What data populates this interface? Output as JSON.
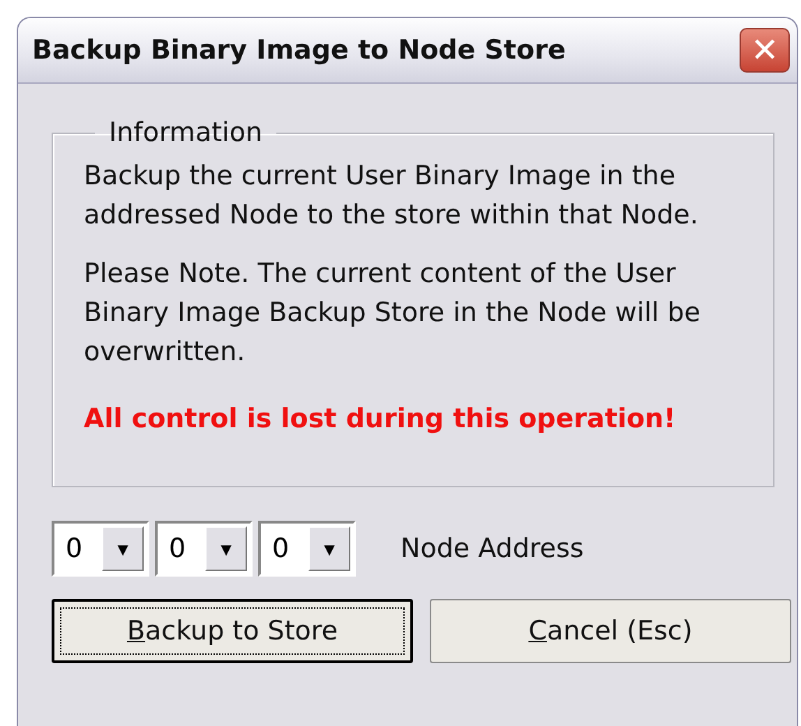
{
  "window": {
    "title": "Backup Binary Image to Node Store",
    "close_glyph": "✕"
  },
  "information": {
    "legend": "Information",
    "paragraphs": [
      {
        "kind": "normal",
        "text": "Backup the current User Binary Image in the addressed Node to the store within that Node."
      },
      {
        "kind": "normal",
        "text": "Please Note. The current content of the User Binary Image Backup Store in the Node will be overwritten."
      },
      {
        "kind": "warning",
        "text": "All control is lost during this operation!"
      }
    ]
  },
  "node_address": {
    "label": "Node Address",
    "combos": [
      {
        "value": "0",
        "arrow": "▼"
      },
      {
        "value": "0",
        "arrow": "▼"
      },
      {
        "value": "0",
        "arrow": "▼"
      }
    ]
  },
  "buttons": [
    {
      "label": "Backup to Store",
      "default": true,
      "access_key_underlined": true
    },
    {
      "label": "Cancel (Esc)",
      "default": false,
      "access_key_underlined": true
    }
  ]
}
